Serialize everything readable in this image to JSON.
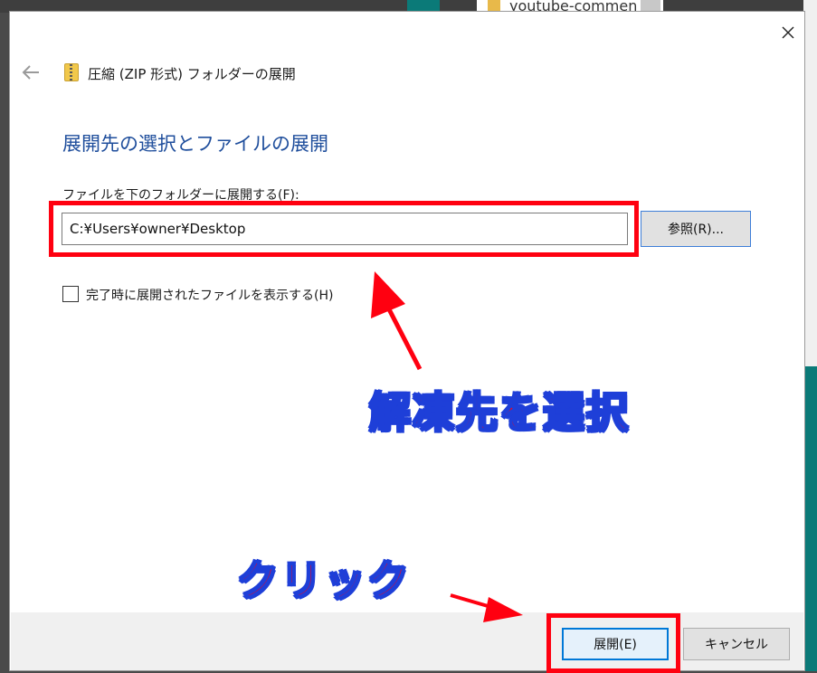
{
  "background": {
    "file_name": "youtube-commen"
  },
  "dialog": {
    "window_title": "圧縮 (ZIP 形式) フォルダーの展開",
    "heading": "展開先の選択とファイルの展開",
    "path_label": "ファイルを下のフォルダーに展開する(F):",
    "path_value": "C:¥Users¥owner¥Desktop",
    "browse_label": "参照(R)...",
    "show_files_label": "完了時に展開されたファイルを表示する(H)",
    "show_files_checked": false,
    "extract_label": "展開(E)",
    "cancel_label": "キャンセル"
  },
  "annotations": {
    "select_destination": "解凍先を選択",
    "click": "クリック",
    "highlight_color": "#ff0010",
    "outline_color": "#1e3fd8"
  },
  "icons": {
    "back": "back-arrow-icon",
    "close": "close-icon",
    "zip": "zip-folder-icon"
  }
}
